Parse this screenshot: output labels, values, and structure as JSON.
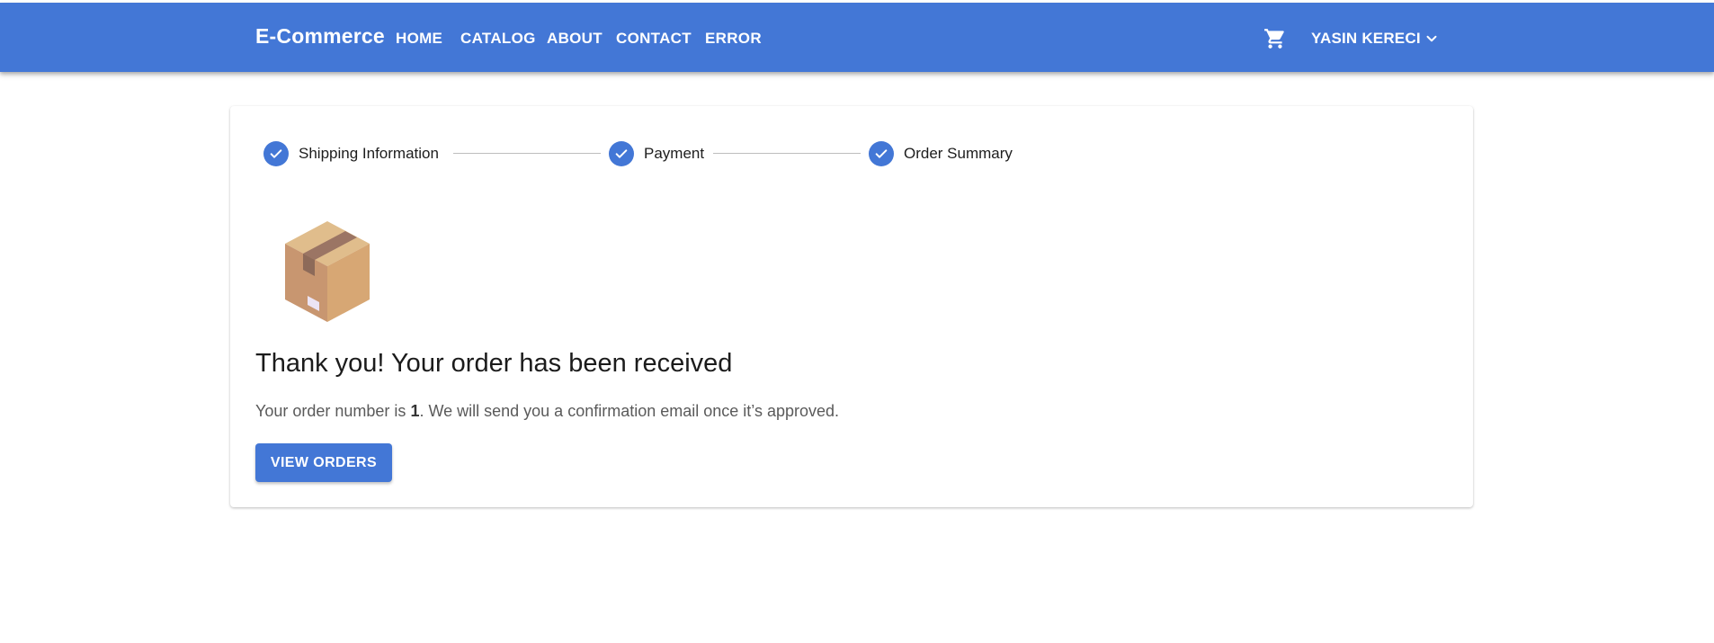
{
  "header": {
    "brand": "E-Commerce",
    "nav": [
      "HOME",
      "CATALOG",
      "ABOUT",
      "CONTACT",
      "ERROR"
    ],
    "cart_icon": "shopping-cart-icon",
    "user_name": "YASIN KERECI",
    "user_menu_icon": "chevron-down-icon"
  },
  "stepper": {
    "steps": [
      "Shipping Information",
      "Payment",
      "Order Summary"
    ],
    "status": "completed"
  },
  "confirmation": {
    "image": "package-box-illustration",
    "title": "Thank you! Your order has been received",
    "message_prefix": "Your order number is ",
    "order_number": "1",
    "message_suffix": ". We will send you a confirmation email once it’s approved.",
    "button_label": "VIEW ORDERS"
  },
  "colors": {
    "primary": "#4377d6",
    "background": "#ffffff"
  }
}
